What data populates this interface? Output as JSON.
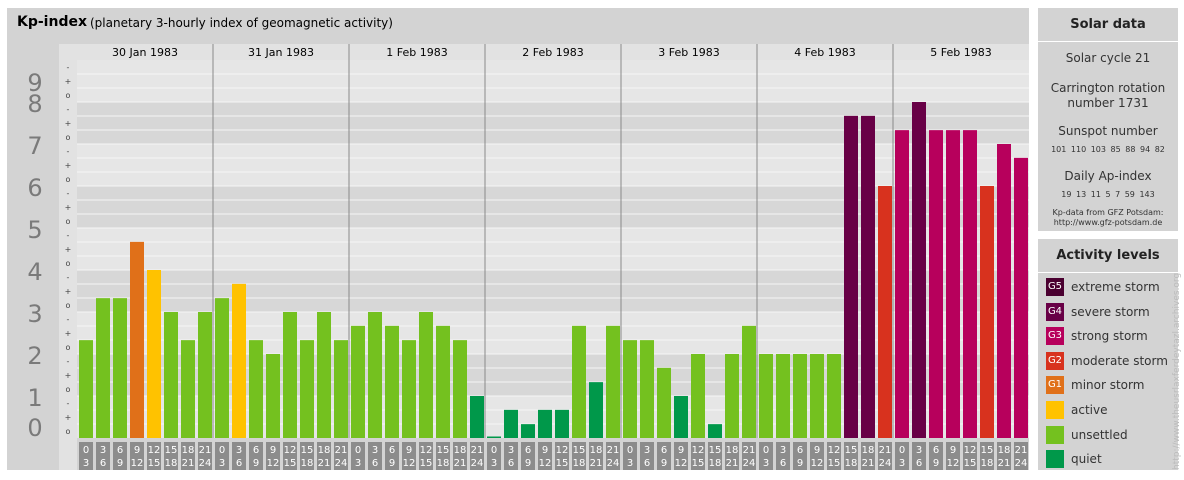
{
  "header": {
    "title": "Kp-index",
    "subtitle": "(planetary 3-hourly index of geomagnetic activity)"
  },
  "chart_data": {
    "type": "bar",
    "title": "Kp-index",
    "subtitle": "(planetary 3-hourly index of geomagnetic activity)",
    "y_axis": {
      "range": [
        0,
        9
      ],
      "major_ticks": [
        "0",
        "1",
        "2",
        "3",
        "4",
        "5",
        "6",
        "7",
        "8",
        "9"
      ],
      "minor_tick_labels": [
        "o",
        "+",
        "-"
      ]
    },
    "days": [
      "30 Jan 1983",
      "31 Jan 1983",
      "1 Feb 1983",
      "2 Feb 1983",
      "3 Feb 1983",
      "4 Feb 1983",
      "5 Feb 1983"
    ],
    "interval_labels": [
      [
        "0",
        "3"
      ],
      [
        "3",
        "6"
      ],
      [
        "6",
        "9"
      ],
      [
        "9",
        "12"
      ],
      [
        "12",
        "15"
      ],
      [
        "15",
        "18"
      ],
      [
        "18",
        "21"
      ],
      [
        "21",
        "24"
      ]
    ],
    "values": [
      [
        2.33,
        3.33,
        3.33,
        4.67,
        4.0,
        3.0,
        2.33,
        3.0
      ],
      [
        3.33,
        3.67,
        2.33,
        2.0,
        3.0,
        2.33,
        3.0,
        2.33
      ],
      [
        2.67,
        3.0,
        2.67,
        2.33,
        3.0,
        2.67,
        2.33,
        1.0
      ],
      [
        0.0,
        0.67,
        0.33,
        0.67,
        0.67,
        2.67,
        1.33,
        2.67
      ],
      [
        2.33,
        2.33,
        1.67,
        1.0,
        2.0,
        0.33,
        2.0,
        2.67
      ],
      [
        2.0,
        2.0,
        2.0,
        2.0,
        2.0,
        7.67,
        7.67,
        6.0
      ],
      [
        7.33,
        8.0,
        7.33,
        7.33,
        7.33,
        6.0,
        7.0,
        6.67
      ]
    ],
    "colors": {
      "quiet": "#00984a",
      "unsettled": "#74c11f",
      "active": "#ffc200",
      "G1": "#e07019",
      "G2": "#d8321e",
      "G3": "#b7005c",
      "G4": "#680046",
      "G5": "#4a0030"
    },
    "grid": true,
    "legend_position": "right"
  },
  "solar": {
    "title": "Solar data",
    "cycle": "Solar cycle 21",
    "carrington_line1": "Carrington rotation",
    "carrington_line2": "number 1731",
    "sunspot_label": "Sunspot number",
    "sunspot_values": "101 110 103 85 88 94 82",
    "ap_label": "Daily Ap-index",
    "ap_values": "19 13 11 5 7 59 143",
    "source_line1": "Kp-data from GFZ Potsdam:",
    "source_line2": "http://www.gfz-potsdam.de"
  },
  "activity": {
    "title": "Activity levels",
    "items": [
      {
        "code": "G5",
        "label": "extreme storm",
        "color": "#4a0030"
      },
      {
        "code": "G4",
        "label": "severe storm",
        "color": "#680046"
      },
      {
        "code": "G3",
        "label": "strong storm",
        "color": "#b7005c"
      },
      {
        "code": "G2",
        "label": "moderate storm",
        "color": "#d8321e"
      },
      {
        "code": "G1",
        "label": "minor storm",
        "color": "#e07019"
      },
      {
        "code": "",
        "label": "active",
        "color": "#ffc200"
      },
      {
        "code": "",
        "label": "unsettled",
        "color": "#74c11f"
      },
      {
        "code": "",
        "label": "quiet",
        "color": "#00984a"
      }
    ]
  },
  "watermark": "http://www.theusrlaxferdeytazl.archives.org"
}
